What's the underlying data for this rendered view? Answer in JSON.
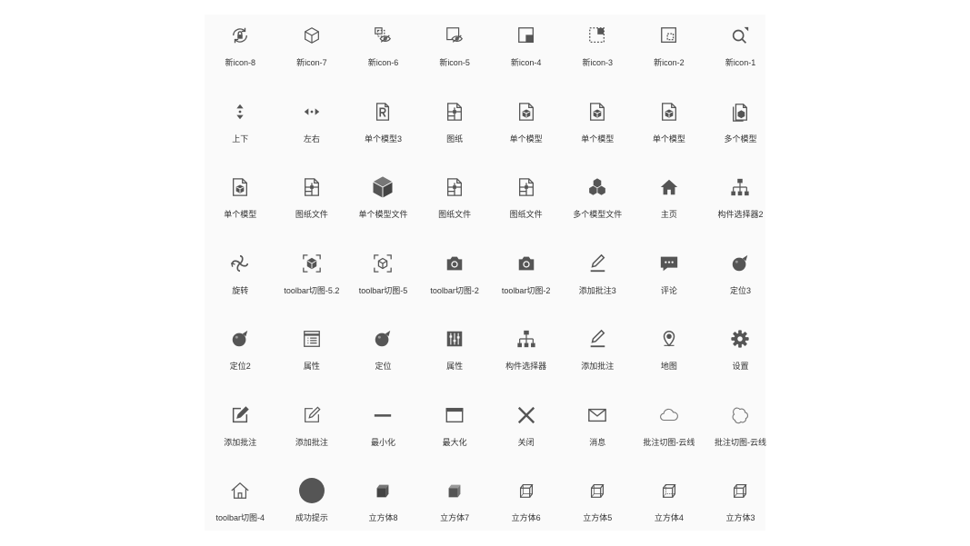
{
  "colors": {
    "background": "#fafafa",
    "icon": "#555555",
    "label": "#333333"
  },
  "icons": [
    {
      "label": "新icon-8",
      "icon": "rotate-lock-icon"
    },
    {
      "label": "新icon-7",
      "icon": "cube-outline-icon"
    },
    {
      "label": "新icon-6",
      "icon": "view-hide-icon"
    },
    {
      "label": "新icon-5",
      "icon": "view-eye-icon"
    },
    {
      "label": "新icon-4",
      "icon": "window-corner-icon"
    },
    {
      "label": "新icon-3",
      "icon": "dashed-select-icon"
    },
    {
      "label": "新icon-2",
      "icon": "frame-select-icon"
    },
    {
      "label": "新icon-1",
      "icon": "search-zoom-icon"
    },
    {
      "label": "上下",
      "icon": "arrow-up-down-icon"
    },
    {
      "label": "左右",
      "icon": "arrow-left-right-icon"
    },
    {
      "label": "单个模型3",
      "icon": "file-r-icon"
    },
    {
      "label": "图纸",
      "icon": "drawing-file-icon"
    },
    {
      "label": "单个模型",
      "icon": "model-file-icon"
    },
    {
      "label": "单个模型",
      "icon": "model-file-icon"
    },
    {
      "label": "单个模型",
      "icon": "model-file-icon"
    },
    {
      "label": "多个模型",
      "icon": "multi-model-file-icon"
    },
    {
      "label": "单个模型",
      "icon": "model-file-icon"
    },
    {
      "label": "图纸文件",
      "icon": "drawing-file-icon"
    },
    {
      "label": "单个模型文件",
      "icon": "cube-solid-icon"
    },
    {
      "label": "图纸文件",
      "icon": "drawing-file-icon"
    },
    {
      "label": "图纸文件",
      "icon": "drawing-file-icon"
    },
    {
      "label": "多个模型文件",
      "icon": "cube-stack-icon"
    },
    {
      "label": "主页",
      "icon": "home-solid-icon"
    },
    {
      "label": "构件选择器2",
      "icon": "hierarchy-icon"
    },
    {
      "label": "旋转",
      "icon": "rotate-orbit-icon"
    },
    {
      "label": "toolbar切图-5.2",
      "icon": "frame-cube-icon"
    },
    {
      "label": "toolbar切图-5",
      "icon": "frame-cube-outline-icon"
    },
    {
      "label": "toolbar切图-2",
      "icon": "camera-icon"
    },
    {
      "label": "toolbar切图-2",
      "icon": "camera-icon"
    },
    {
      "label": "添加批注3",
      "icon": "pen-line-icon"
    },
    {
      "label": "评论",
      "icon": "comment-icon"
    },
    {
      "label": "定位3",
      "icon": "locate-ball-icon"
    },
    {
      "label": "定位2",
      "icon": "locate-ball-icon"
    },
    {
      "label": "属性",
      "icon": "properties-list-icon"
    },
    {
      "label": "定位",
      "icon": "locate-ball-icon"
    },
    {
      "label": "属性",
      "icon": "sliders-icon"
    },
    {
      "label": "构件选择器",
      "icon": "hierarchy-icon"
    },
    {
      "label": "添加批注",
      "icon": "pen-line-icon"
    },
    {
      "label": "地图",
      "icon": "map-pin-icon"
    },
    {
      "label": "设置",
      "icon": "gear-icon"
    },
    {
      "label": "添加批注",
      "icon": "edit-square-icon"
    },
    {
      "label": "添加批注",
      "icon": "edit-square-outline-icon"
    },
    {
      "label": "最小化",
      "icon": "minimize-icon"
    },
    {
      "label": "最大化",
      "icon": "maximize-icon"
    },
    {
      "label": "关闭",
      "icon": "close-icon"
    },
    {
      "label": "消息",
      "icon": "mail-icon"
    },
    {
      "label": "批注切图-云线",
      "icon": "cloud-icon"
    },
    {
      "label": "批注切图-云线",
      "icon": "cloud-flower-icon"
    },
    {
      "label": "toolbar切图-4",
      "icon": "home-outline-icon"
    },
    {
      "label": "成功提示",
      "icon": "circle-solid-icon"
    },
    {
      "label": "立方体8",
      "icon": "cube-dark-icon"
    },
    {
      "label": "立方体7",
      "icon": "cube-mid-icon"
    },
    {
      "label": "立方体6",
      "icon": "cube-wire-icon"
    },
    {
      "label": "立方体5",
      "icon": "cube-wire-icon"
    },
    {
      "label": "立方体4",
      "icon": "cube-wire-light-icon"
    },
    {
      "label": "立方体3",
      "icon": "cube-wire-icon"
    }
  ]
}
